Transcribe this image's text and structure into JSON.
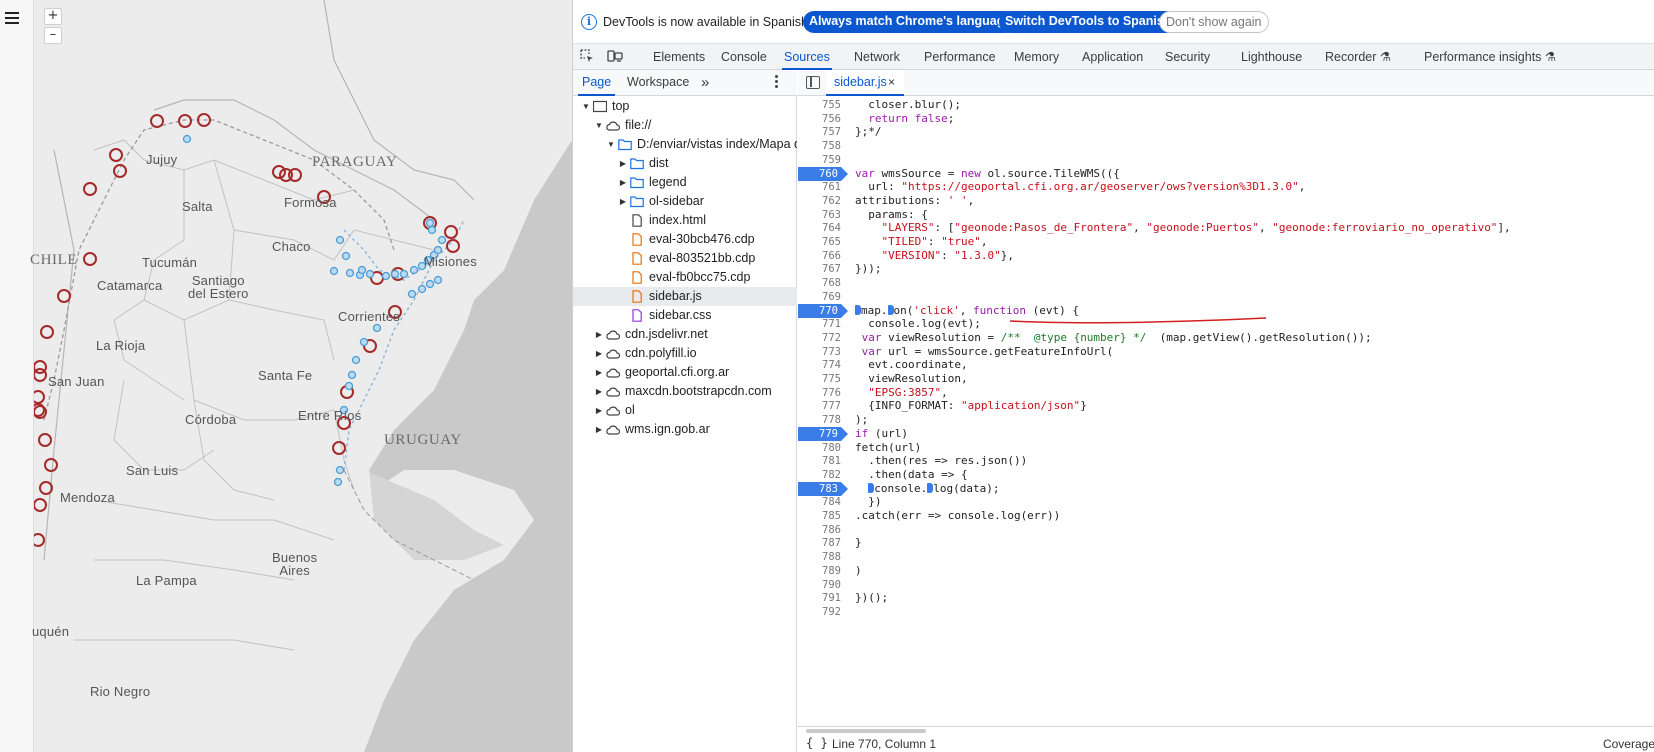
{
  "map": {
    "zoom_in": "+",
    "zoom_out": "–",
    "labels": {
      "paraguay": "PARAGUAY",
      "uruguay": "URUGUAY",
      "chile": "CHILE",
      "jujuy": "Jujuy",
      "salta": "Salta",
      "formosa": "Formosa",
      "chaco": "Chaco",
      "tucuman": "Tucumán",
      "catamarca": "Catamarca",
      "santiago_1": "Santiago",
      "santiago_2": "del Estero",
      "misiones": "Misiones",
      "corrientes": "Corrientes",
      "la_rioja": "La Rioja",
      "san_juan": "San Juan",
      "santa_fe": "Santa Fe",
      "entre_rios": "Entre Ríos",
      "cordoba": "Córdoba",
      "san_luis": "San Luis",
      "mendoza": "Mendoza",
      "buenos_1": "Buenos",
      "buenos_2": "Aires",
      "la_pampa": "La Pampa",
      "neuquen": "uquén",
      "rio_negro": "Rio Negro"
    }
  },
  "infobar": {
    "message": "DevTools is now available in Spanish!",
    "btn_match": "Always match Chrome's language",
    "btn_switch": "Switch DevTools to Spanish",
    "btn_dismiss": "Don't show again"
  },
  "tabs": [
    "Elements",
    "Console",
    "Sources",
    "Network",
    "Performance",
    "Memory",
    "Application",
    "Security",
    "Lighthouse",
    "Recorder",
    "Performance insights"
  ],
  "active_tab": "Sources",
  "navigator": {
    "tab_page": "Page",
    "tab_workspace": "Workspace",
    "more": "»",
    "tree": [
      {
        "label": "top",
        "level": 0,
        "expand": "open",
        "icon": "frame"
      },
      {
        "label": "file://",
        "level": 1,
        "expand": "open",
        "icon": "cloud"
      },
      {
        "label": "D:/enviar/vistas index/Mapa di",
        "level": 2,
        "expand": "open",
        "icon": "folder"
      },
      {
        "label": "dist",
        "level": 3,
        "expand": "closed",
        "icon": "folder"
      },
      {
        "label": "legend",
        "level": 3,
        "expand": "closed",
        "icon": "folder"
      },
      {
        "label": "ol-sidebar",
        "level": 3,
        "expand": "closed",
        "icon": "folder"
      },
      {
        "label": "index.html",
        "level": 3,
        "expand": "none",
        "icon": "file"
      },
      {
        "label": "eval-30bcb476.cdp",
        "level": 3,
        "expand": "none",
        "icon": "file-orange"
      },
      {
        "label": "eval-803521bb.cdp",
        "level": 3,
        "expand": "none",
        "icon": "file-orange"
      },
      {
        "label": "eval-fb0bcc75.cdp",
        "level": 3,
        "expand": "none",
        "icon": "file-orange"
      },
      {
        "label": "sidebar.js",
        "level": 3,
        "expand": "none",
        "icon": "file-orange",
        "selected": true
      },
      {
        "label": "sidebar.css",
        "level": 3,
        "expand": "none",
        "icon": "file-purple"
      },
      {
        "label": "cdn.jsdelivr.net",
        "level": 1,
        "expand": "closed",
        "icon": "cloud"
      },
      {
        "label": "cdn.polyfill.io",
        "level": 1,
        "expand": "closed",
        "icon": "cloud"
      },
      {
        "label": "geoportal.cfi.org.ar",
        "level": 1,
        "expand": "closed",
        "icon": "cloud"
      },
      {
        "label": "maxcdn.bootstrapcdn.com",
        "level": 1,
        "expand": "closed",
        "icon": "cloud"
      },
      {
        "label": "ol",
        "level": 1,
        "expand": "closed",
        "icon": "cloud"
      },
      {
        "label": "wms.ign.gob.ar",
        "level": 1,
        "expand": "closed",
        "icon": "cloud"
      }
    ]
  },
  "editor": {
    "file_tab": "sidebar.js",
    "close": "×",
    "lines": [
      {
        "n": 755,
        "html": "  closer.blur();"
      },
      {
        "n": 756,
        "html": "  <span class=\"kw\">return</span> <span class=\"kw\">false</span>;"
      },
      {
        "n": 757,
        "html": "};*/"
      },
      {
        "n": 758,
        "html": ""
      },
      {
        "n": 759,
        "html": ""
      },
      {
        "n": 760,
        "bp": true,
        "html": "<span class=\"kw\">var</span> wmsSource = <span class=\"kw\">new</span> ol.source.TileWMS(({"
      },
      {
        "n": 761,
        "html": "  url: <span class=\"str\">\"https://geoportal.cfi.org.ar/geoserver/ows?version%3D1.3.0\"</span>,"
      },
      {
        "n": 762,
        "html": "attributions: <span class=\"str\">' '</span>,"
      },
      {
        "n": 763,
        "html": "  params: {"
      },
      {
        "n": 764,
        "html": "    <span class=\"str\">\"LAYERS\"</span>: [<span class=\"str\">\"geonode:Pasos_de_Frontera\"</span>, <span class=\"str\">\"geonode:Puertos\"</span>, <span class=\"str\">\"geonode:ferroviario_no_operativo\"</span>],"
      },
      {
        "n": 765,
        "html": "    <span class=\"str\">\"TILED\"</span>: <span class=\"str\">\"true\"</span>,"
      },
      {
        "n": 766,
        "html": "    <span class=\"str\">\"VERSION\"</span>: <span class=\"str\">\"1.3.0\"</span>},"
      },
      {
        "n": 767,
        "html": "}));"
      },
      {
        "n": 768,
        "html": ""
      },
      {
        "n": 769,
        "html": ""
      },
      {
        "n": 770,
        "bp": true,
        "html": "<span class=\"inline-bp\"></span>map.<span class=\"inline-bp\"></span>on(<span class=\"str\">'click'</span>, <span class=\"kw\">function</span> (evt) {"
      },
      {
        "n": 771,
        "html": "  console.log(evt);"
      },
      {
        "n": 772,
        "html": " <span class=\"kw\">var</span> viewResolution = <span class=\"cmt\">/**  @type {number} */</span>  (map.getView().getResolution());"
      },
      {
        "n": 773,
        "html": " <span class=\"kw\">var</span> url = wmsSource.getFeatureInfoUrl("
      },
      {
        "n": 774,
        "html": "  evt.coordinate,"
      },
      {
        "n": 775,
        "html": "  viewResolution,"
      },
      {
        "n": 776,
        "html": "  <span class=\"str\">\"EPSG:3857\"</span>,"
      },
      {
        "n": 777,
        "html": "  {INFO_FORMAT: <span class=\"str\">\"application/json\"</span>}"
      },
      {
        "n": 778,
        "html": ");"
      },
      {
        "n": 779,
        "bp": true,
        "html": "<span class=\"kw\">if</span> (url)"
      },
      {
        "n": 780,
        "html": "fetch(url)"
      },
      {
        "n": 781,
        "html": "  .then(res =&gt; res.json())"
      },
      {
        "n": 782,
        "html": "  .then(data =&gt; {"
      },
      {
        "n": 783,
        "bp": true,
        "html": "  <span class=\"inline-bp\"></span>console.<span class=\"inline-bp\"></span>log(data);"
      },
      {
        "n": 784,
        "html": "  })"
      },
      {
        "n": 785,
        "html": ".catch(err =&gt; console.log(err))"
      },
      {
        "n": 786,
        "html": ""
      },
      {
        "n": 787,
        "html": "}"
      },
      {
        "n": 788,
        "html": ""
      },
      {
        "n": 789,
        "html": ")"
      },
      {
        "n": 790,
        "html": ""
      },
      {
        "n": 791,
        "html": "})();"
      },
      {
        "n": 792,
        "html": ""
      }
    ]
  },
  "status": {
    "braces": "{ }",
    "position": "Line 770, Column 1",
    "coverage": "Coverage"
  },
  "colors": {
    "accent": "#0b57d0",
    "breakpoint": "#3a7de8",
    "port_marker": "#a52a2a",
    "rail_marker": "#4a9cd6"
  }
}
